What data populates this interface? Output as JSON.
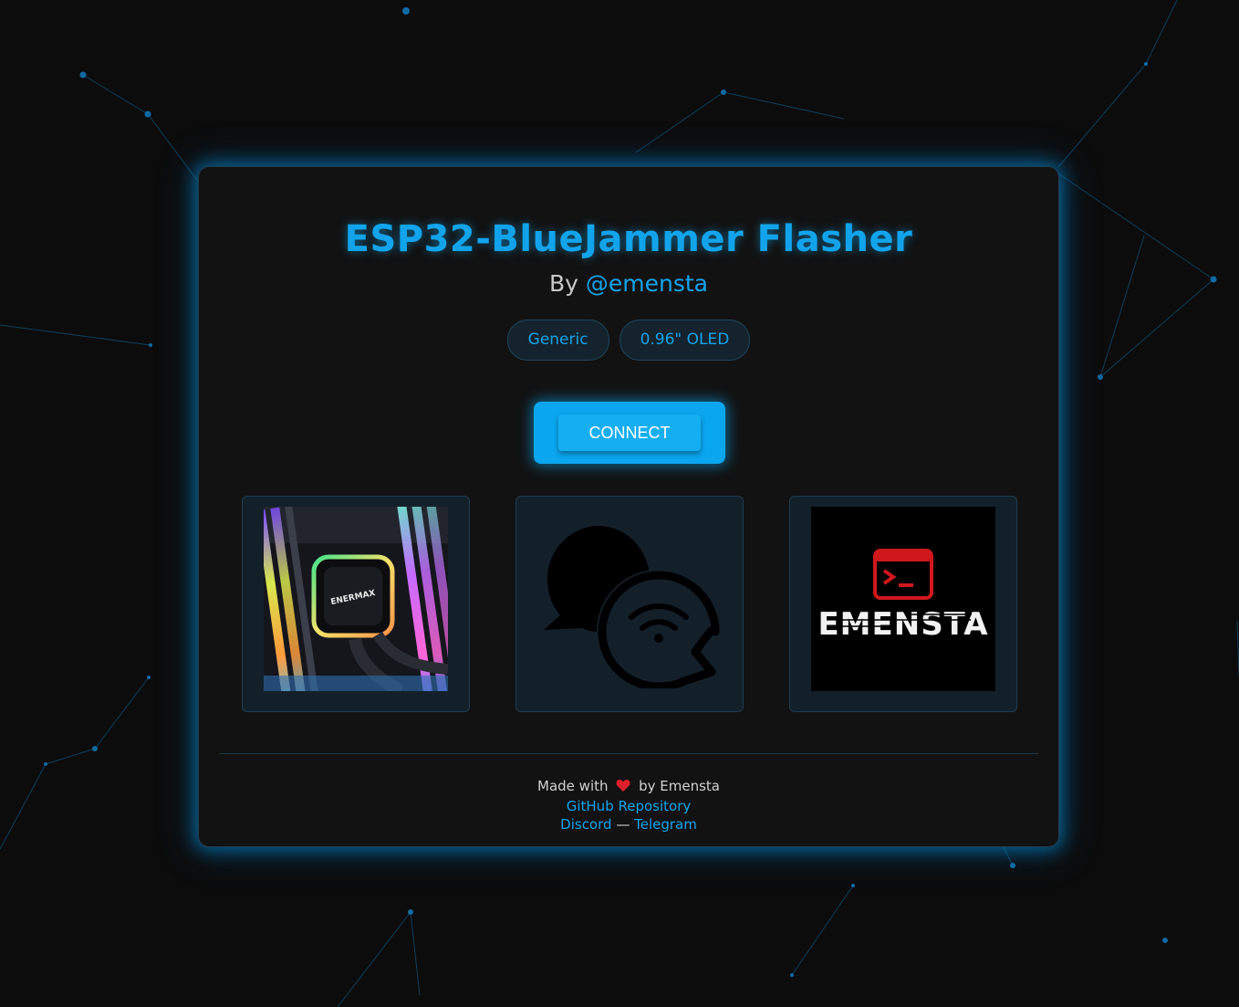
{
  "header": {
    "title": "ESP32-BlueJammer Flasher",
    "by_prefix": "By",
    "author_handle": "@emensta"
  },
  "tags": [
    "Generic",
    "0.96\" OLED"
  ],
  "connect_label": "CONNECT",
  "tiles": [
    {
      "name": "pc-build-image",
      "icon": "rgb-pc-photo"
    },
    {
      "name": "discord-chat-wifi",
      "icon": "chat-wifi-icon"
    },
    {
      "name": "emensta-logo",
      "icon": "terminal-icon",
      "logo_text": "EMENSTA"
    }
  ],
  "footer": {
    "made_with": "Made with",
    "by": "by Emensta",
    "github_label": "GitHub Repository",
    "discord_label": "Discord",
    "separator": "—",
    "telegram_label": "Telegram"
  },
  "colors": {
    "accent": "#11a4ec",
    "background": "#0c0c0c",
    "card": "#121212",
    "heart": "#e0212b"
  }
}
